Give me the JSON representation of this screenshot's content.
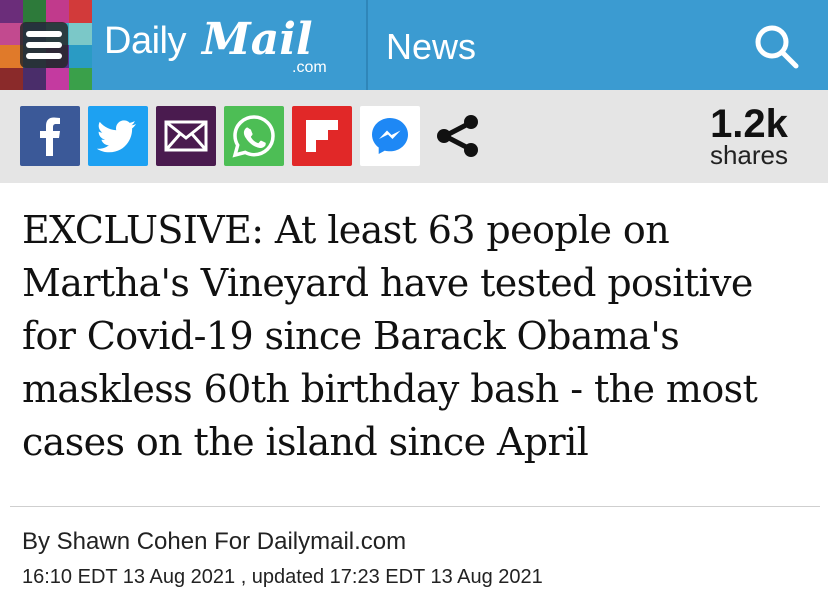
{
  "header": {
    "logo_daily": "Daily",
    "logo_mail": "Mail",
    "logo_com": ".com",
    "nav_label": "News",
    "colors": {
      "background": "#3b9bd1"
    }
  },
  "share": {
    "buttons": [
      {
        "name": "facebook",
        "icon": "facebook-icon",
        "color": "#3b5998"
      },
      {
        "name": "twitter",
        "icon": "twitter-icon",
        "color": "#1da1f2"
      },
      {
        "name": "email",
        "icon": "email-icon",
        "color": "#4a1b4f"
      },
      {
        "name": "whatsapp",
        "icon": "whatsapp-icon",
        "color": "#4dbe55"
      },
      {
        "name": "flipboard",
        "icon": "flipboard-icon",
        "color": "#e12828"
      },
      {
        "name": "messenger",
        "icon": "messenger-icon",
        "color": "#ffffff"
      },
      {
        "name": "more-share",
        "icon": "share-icon",
        "color": "#e5e5e5"
      }
    ],
    "count": "1.2k",
    "count_label": "shares"
  },
  "article": {
    "headline": "EXCLUSIVE: At least 63 people on Martha's Vineyard have tested positive for Covid-19 since Barack Obama's maskless 60th birthday bash - the most cases on the island since April",
    "byline": "By Shawn Cohen For Dailymail.com",
    "dateline": "16:10 EDT 13 Aug 2021 , updated 17:23 EDT 13 Aug 2021"
  }
}
